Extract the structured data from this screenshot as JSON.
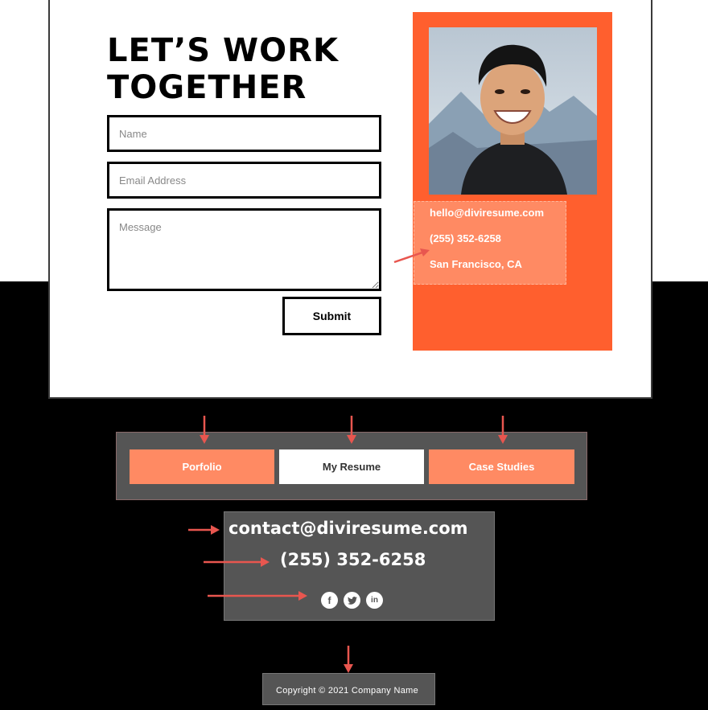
{
  "form": {
    "title_line1": "LET’S WORK",
    "title_line2": "TOGETHER",
    "name_placeholder": "Name",
    "email_placeholder": "Email Address",
    "message_placeholder": "Message",
    "submit_label": "Submit"
  },
  "profile": {
    "email": "hello@diviresume.com",
    "phone": "(255) 352-6258",
    "location": "San Francisco, CA"
  },
  "nav_buttons": [
    {
      "label": "Porfolio"
    },
    {
      "label": "My Resume"
    },
    {
      "label": "Case Studies"
    }
  ],
  "footer": {
    "email": "contact@diviresume.com",
    "phone": "(255) 352-6258",
    "social_icons": [
      "facebook-icon",
      "twitter-icon",
      "linkedin-icon"
    ],
    "copyright": "Copyright © 2021 Company Name"
  },
  "colors": {
    "accent_orange": "#ff5f2e",
    "light_orange": "#ff8a63",
    "dark_gray": "#555555",
    "annotation_red": "#e8564f"
  }
}
